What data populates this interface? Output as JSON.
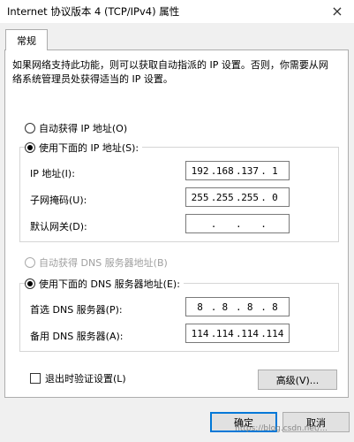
{
  "window": {
    "title": "Internet 协议版本 4 (TCP/IPv4) 属性",
    "close_glyph": "×"
  },
  "tabs": [
    {
      "label": "常规"
    }
  ],
  "description_line1": "如果网络支持此功能，则可以获取自动指派的 IP 设置。否则，你需要从网",
  "description_line2": "络系统管理员处获得适当的 IP 设置。",
  "ip_section": {
    "auto_label": "自动获得 IP 地址(O)",
    "manual_label": "使用下面的 IP 地址(S):",
    "fields": [
      {
        "label": "IP 地址(I):",
        "octets": [
          "192",
          "168",
          "137",
          "1"
        ]
      },
      {
        "label": "子网掩码(U):",
        "octets": [
          "255",
          "255",
          "255",
          "0"
        ]
      },
      {
        "label": "默认网关(D):",
        "octets": [
          "",
          "",
          "",
          ""
        ]
      }
    ]
  },
  "dns_section": {
    "auto_label": "自动获得 DNS 服务器地址(B)",
    "manual_label": "使用下面的 DNS 服务器地址(E):",
    "fields": [
      {
        "label": "首选 DNS 服务器(P):",
        "octets": [
          "8",
          "8",
          "8",
          "8"
        ]
      },
      {
        "label": "备用 DNS 服务器(A):",
        "octets": [
          "114",
          "114",
          "114",
          "114"
        ]
      }
    ]
  },
  "validate_label": "退出时验证设置(L)",
  "advanced_button": "高级(V)...",
  "ok_button": "确定",
  "cancel_button": "取消",
  "watermark_text": "https://blog.csdn.net/..."
}
